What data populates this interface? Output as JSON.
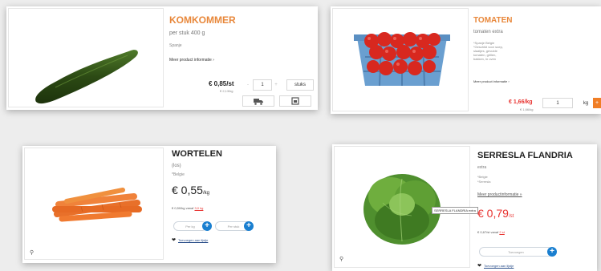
{
  "products": {
    "komkommer": {
      "title": "KOMKOMMER",
      "subtitle": "per stuk  400 g",
      "origin": "Spanje",
      "more_info": "Meer product informatie ›",
      "price": "€ 0,85/st",
      "unit_price": "€ 2,13/kg",
      "qty": "1",
      "minus": "-",
      "plus": "+",
      "unit": "stuks",
      "delivery_icon": "truck-icon",
      "pickup_icon": "store-icon"
    },
    "tomaten": {
      "title": "TOMATEN",
      "subtitle": "tomaten extra",
      "details": [
        "*Spanje Belgie",
        "*Geschikt voor soep,",
        "slaatjes, gevulde",
        "tomaten, grillen,",
        "bakken, in oven"
      ],
      "more_info": "Meer product informatie ›",
      "price": "€ 1,66/kg",
      "unit_price": "€ 1,66/kg",
      "qty": "1",
      "unit": "kg",
      "add": "+"
    },
    "wortelen": {
      "title": "WORTELEN",
      "subtitle": "(los)",
      "origin": "*Belgie",
      "price_main": "€ 0,55",
      "price_unit": "/kg",
      "volume_note": "€ 0,50/kg vanaf ",
      "volume_link": "3,0 kg",
      "pill1": "Per kg",
      "pill2": "Per stuk",
      "add_to_list": "Toevoegen aan lijstje",
      "zoom_icon": "magnifier-icon"
    },
    "serresla": {
      "title": "SERRESLA FLANDRIA",
      "subtitle": "extra",
      "details": [
        "*Belgie",
        "*Serresla"
      ],
      "more_info": "Meer productinformatie »",
      "tooltip": "SERRESLA FLANDRIA extra",
      "price_main": "€ 0,79",
      "price_unit": "/st",
      "volume_note": "€ 0,67/st vanaf ",
      "volume_link": "2 st",
      "pill1": "Toevoegen",
      "add_to_list": "Toevoegen aan lijstje",
      "zoom_icon": "magnifier-icon"
    }
  },
  "colors": {
    "accent_orange": "#e8873a",
    "price_red": "#e8322f",
    "button_blue": "#1a7fd0"
  }
}
